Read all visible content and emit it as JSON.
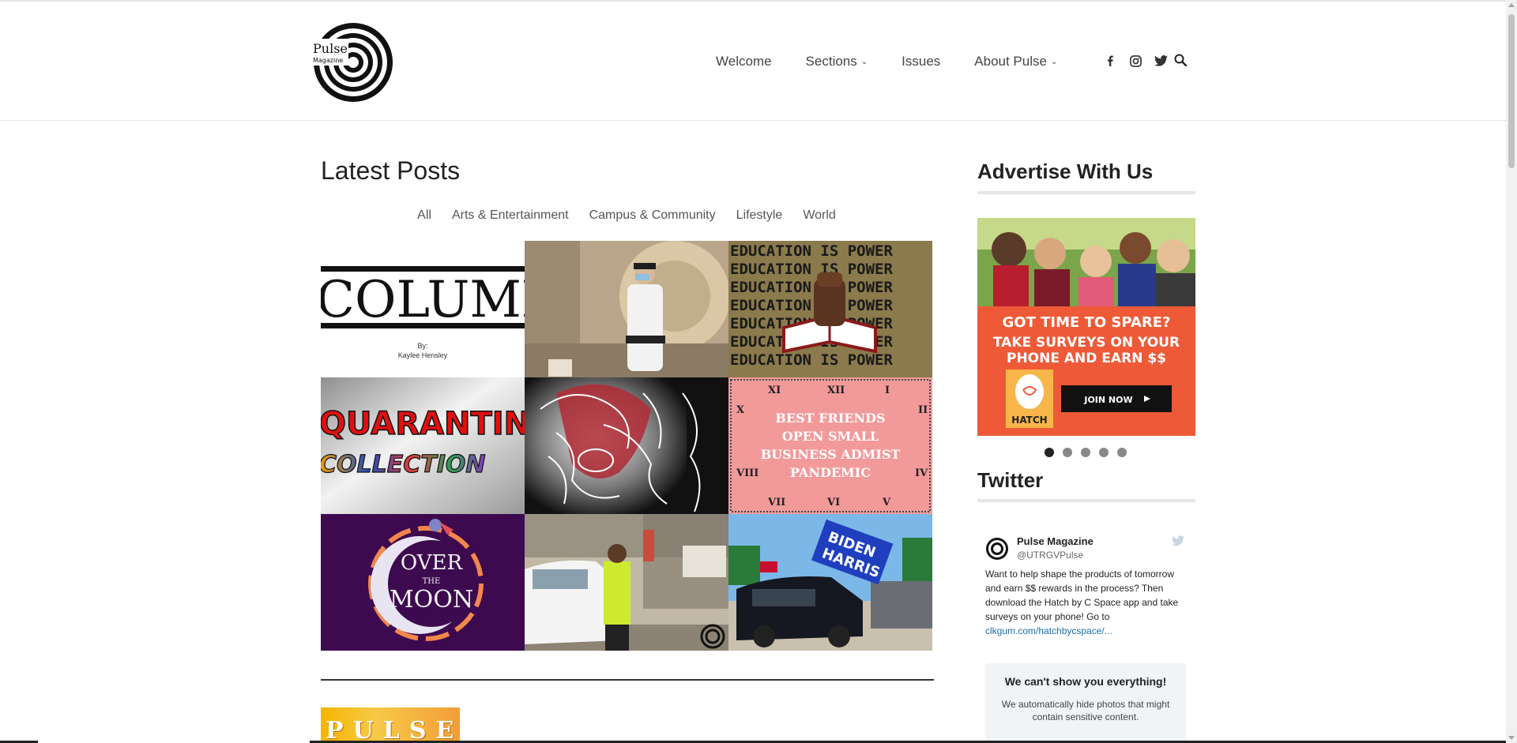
{
  "brand": {
    "logo_line1": "Pulse",
    "logo_line2": "Magazine"
  },
  "nav": {
    "items": [
      {
        "label": "Welcome",
        "dropdown": false
      },
      {
        "label": "Sections",
        "dropdown": true
      },
      {
        "label": "Issues",
        "dropdown": false
      },
      {
        "label": "About Pulse",
        "dropdown": true
      }
    ],
    "social": [
      "facebook-icon",
      "instagram-icon",
      "twitter-icon"
    ],
    "search_icon": "search-icon"
  },
  "main": {
    "title": "Latest Posts",
    "filters": [
      "All",
      "Arts & Entertainment",
      "Campus & Community",
      "Lifestyle",
      "World"
    ],
    "tiles": {
      "column_word": "COLUMN",
      "column_by": "By:",
      "column_author": "Kaylee Hensley",
      "education_line": "EDUCATION IS POWER",
      "quarantine_line1": "QUARANTINE",
      "quarantine_line2": "COLLECTION",
      "best_friends_lines": [
        "BEST FRIENDS",
        "OPEN SMALL",
        "BUSINESS ADMIST",
        "PANDEMIC"
      ],
      "moon_line1": "OVER",
      "moon_line2": "THE",
      "moon_line3": "MOON",
      "flag_line1": "BIDEN",
      "flag_line2": "HARRIS"
    },
    "bottom_thumb_text": "PULSE"
  },
  "sidebar": {
    "advertise_title": "Advertise With Us",
    "ad": {
      "headline1": "GOT TIME TO SPARE?",
      "headline2": "TAKE SURVEYS ON YOUR",
      "headline3": "PHONE AND EARN $$",
      "button": "JOIN NOW",
      "brand": "HATCH",
      "accent": "#ee5a37"
    },
    "carousel": {
      "count": 5,
      "active": 1
    },
    "twitter_title": "Twitter",
    "tweet": {
      "name": "Pulse Magazine",
      "handle": "@UTRGVPulse",
      "text": "Want to help shape the products of tomorrow and earn $$ rewards in the process? Then download the Hatch by C Space app and take surveys on your phone! Go to",
      "link": "clkgum.com/hatchbycspace/..."
    },
    "sensitive": {
      "heading": "We can't show you everything!",
      "body": "We automatically hide photos that might contain sensitive content."
    }
  }
}
